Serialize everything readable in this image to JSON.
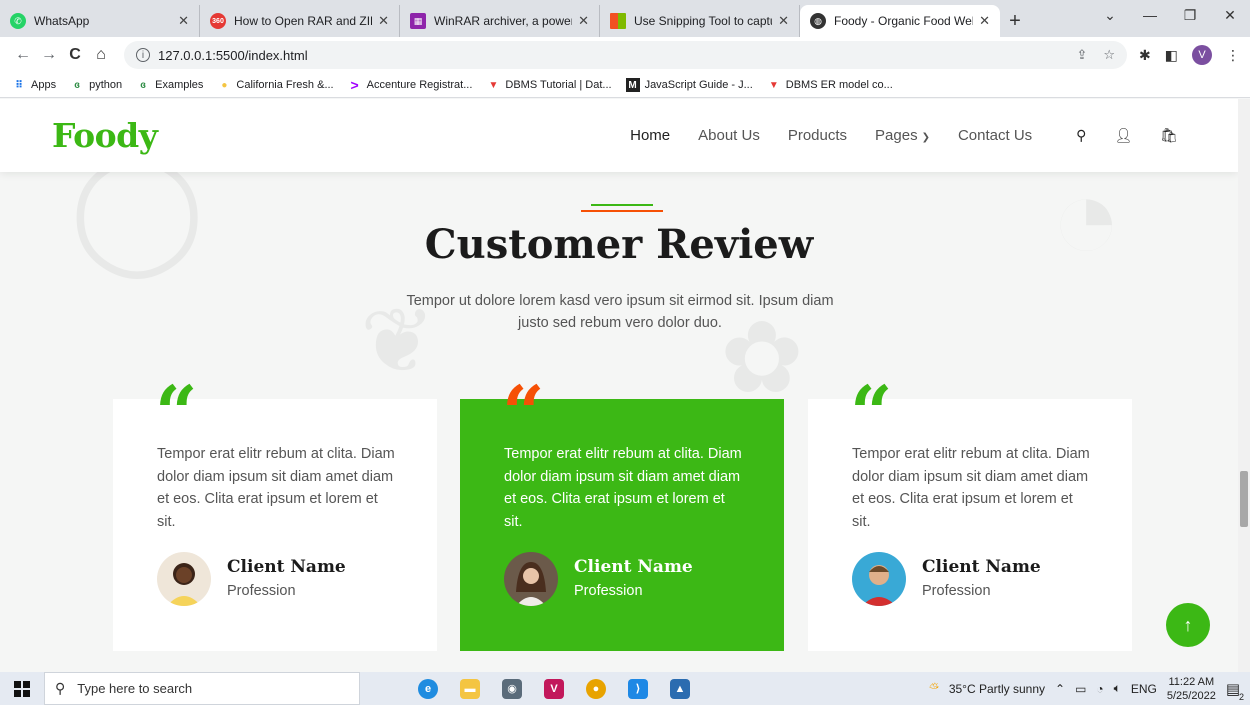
{
  "browser": {
    "tabs": [
      {
        "title": "WhatsApp",
        "icon": "whatsapp-icon",
        "color": "#25d366",
        "glyph": "✆"
      },
      {
        "title": "How to Open RAR and ZIP Fi",
        "icon": "360-icon",
        "color": "#e53935",
        "glyph": "360"
      },
      {
        "title": "WinRAR archiver, a powerful",
        "icon": "winrar-icon",
        "color": "#8e24aa",
        "glyph": "▦"
      },
      {
        "title": "Use Snipping Tool to capture",
        "icon": "microsoft-icon",
        "color": "#f25022",
        "glyph": "■"
      },
      {
        "title": "Foody - Organic Food Websi",
        "icon": "globe-icon",
        "color": "#333333",
        "glyph": "●",
        "active": true
      }
    ],
    "url": "127.0.0.1:5500/index.html",
    "profile_initial": "V",
    "bookmarks": [
      {
        "label": "Apps",
        "icon": "apps-grid-icon",
        "glyph": "⠿",
        "color": "#1a73e8"
      },
      {
        "label": "python",
        "icon": "geeks-icon",
        "glyph": "ɞ",
        "color": "#2f8d46"
      },
      {
        "label": "Examples",
        "icon": "geeks-icon",
        "glyph": "ɞ",
        "color": "#2f8d46"
      },
      {
        "label": "California Fresh &...",
        "icon": "california-icon",
        "glyph": "●",
        "color": "#f4c542"
      },
      {
        "label": "Accenture Registrat...",
        "icon": "accenture-icon",
        "glyph": ">",
        "color": "#a100ff"
      },
      {
        "label": "DBMS Tutorial | Dat...",
        "icon": "dbms-icon",
        "glyph": "▼",
        "color": "#e53935"
      },
      {
        "label": "JavaScript Guide - J...",
        "icon": "mdn-icon",
        "glyph": "M",
        "color": "#222222"
      },
      {
        "label": "DBMS ER model co...",
        "icon": "dbms-icon",
        "glyph": "▼",
        "color": "#e53935"
      }
    ]
  },
  "site": {
    "logo": "Foody",
    "menu": [
      "Home",
      "About Us",
      "Products",
      "Pages",
      "Contact Us"
    ],
    "section_title": "Customer Review",
    "section_subtitle": "Tempor ut dolore lorem kasd vero ipsum sit eirmod sit. Ipsum diam justo sed rebum vero dolor duo.",
    "testimonials": [
      {
        "text": "Tempor erat elitr rebum at clita. Diam dolor diam ipsum sit diam amet diam et eos. Clita erat ipsum et lorem et sit.",
        "name": "Client Name",
        "profession": "Profession"
      },
      {
        "text": "Tempor erat elitr rebum at clita. Diam dolor diam ipsum sit diam amet diam et eos. Clita erat ipsum et lorem et sit.",
        "name": "Client Name",
        "profession": "Profession"
      },
      {
        "text": "Tempor erat elitr rebum at clita. Diam dolor diam ipsum sit diam amet diam et eos. Clita erat ipsum et lorem et sit.",
        "name": "Client Name",
        "profession": "Profession"
      }
    ],
    "quote_glyph": "“",
    "colors": {
      "primary": "#3cb815",
      "secondary": "#f65005"
    }
  },
  "taskbar": {
    "search_placeholder": "Type here to search",
    "weather": "35°C  Partly sunny",
    "lang": "ENG",
    "time": "11:22 AM",
    "date": "5/25/2022",
    "notif_count": "2"
  }
}
